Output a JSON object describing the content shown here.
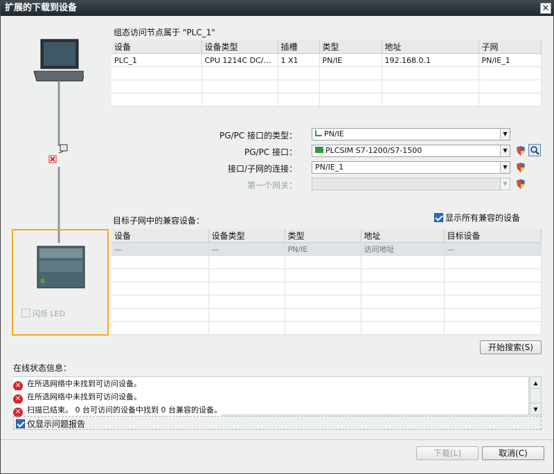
{
  "window": {
    "title": "扩展的下载到设备",
    "close": "✕"
  },
  "config": {
    "heading": "组态访问节点属于 \"PLC_1\"",
    "columns": [
      "设备",
      "设备类型",
      "插槽",
      "类型",
      "地址",
      "子网"
    ],
    "rows": [
      [
        "PLC_1",
        "CPU 1214C DC/D...",
        "1 X1",
        "PN/IE",
        "192.168.0.1",
        "PN/IE_1"
      ]
    ]
  },
  "interface": {
    "pgpc_type_label": "PG/PC 接口的类型：",
    "pgpc_type_value": "PN/IE",
    "pgpc_label": "PG/PC 接口：",
    "pgpc_value": "PLCSIM S7-1200/S7-1500",
    "subnet_label": "接口/子网的连接：",
    "subnet_value": "PN/IE_1",
    "gateway_label": "第一个网关：",
    "gateway_value": ""
  },
  "compatible": {
    "heading": "目标子网中的兼容设备：",
    "show_all_label": "显示所有兼容的设备",
    "show_all_checked": true,
    "columns": [
      "设备",
      "设备类型",
      "类型",
      "地址",
      "目标设备"
    ],
    "rows": [
      [
        "—",
        "—",
        "PN/IE",
        "访问地址",
        "—"
      ]
    ],
    "start_search": "开始搜索(S)"
  },
  "left": {
    "flash_led": "闪烁 LED"
  },
  "status": {
    "heading": "在线状态信息：",
    "messages": [
      "在所选网络中未找到可访问设备。",
      "在所选网络中未找到可访问设备。",
      "扫描已结束。 0 台可访问的设备中找到 0 台兼容的设备。"
    ],
    "only_problems": "仅显示问题报告"
  },
  "footer": {
    "download": "下载(L)",
    "cancel": "取消(C)"
  },
  "colors": {
    "highlight": "#f5a623",
    "error": "#d8262c"
  }
}
